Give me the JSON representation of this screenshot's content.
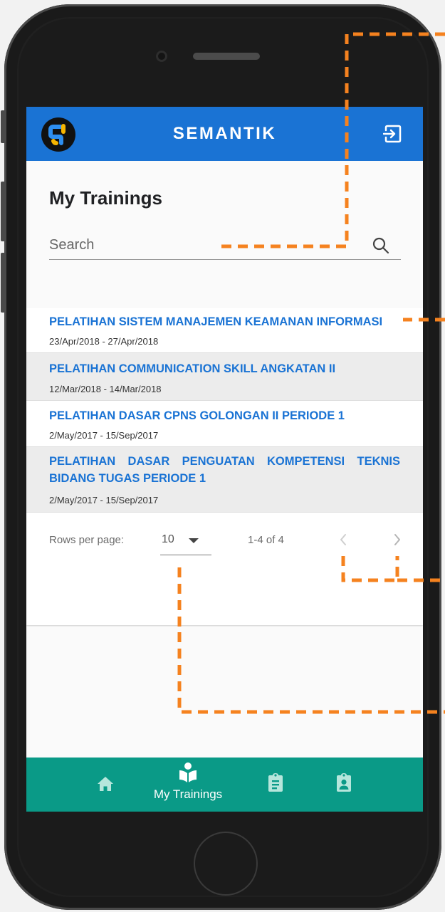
{
  "app": {
    "title": "SEMANTIK"
  },
  "page": {
    "title": "My Trainings"
  },
  "search": {
    "placeholder": "Search"
  },
  "trainings": [
    {
      "title": "PELATIHAN SISTEM MANAJEMEN KEAMANAN INFORMASI",
      "dates": "23/Apr/2018 - 27/Apr/2018"
    },
    {
      "title": "PELATIHAN COMMUNICATION SKILL ANGKATAN II",
      "dates": "12/Mar/2018 - 14/Mar/2018"
    },
    {
      "title": "PELATIHAN DASAR CPNS GOLONGAN II PERIODE 1",
      "dates": "2/May/2017 - 15/Sep/2017"
    },
    {
      "title": "PELATIHAN DASAR PENGUATAN KOMPETENSI TEKNIS BIDANG TUGAS PERIODE 1",
      "dates": "2/May/2017 - 15/Sep/2017"
    }
  ],
  "pagination": {
    "rows_per_page_label": "Rows per page:",
    "rows_per_page_value": "10",
    "range": "1-4 of 4"
  },
  "bottom_nav": {
    "items": [
      {
        "icon": "home-icon",
        "label": ""
      },
      {
        "icon": "book-reader-icon",
        "label": "My Trainings",
        "active": true
      },
      {
        "icon": "clipboard-list-icon",
        "label": ""
      },
      {
        "icon": "clipboard-user-icon",
        "label": ""
      }
    ]
  },
  "colors": {
    "primary": "#1a73d4",
    "bottom_nav": "#0a9a87",
    "annotation": "#f5821f"
  }
}
